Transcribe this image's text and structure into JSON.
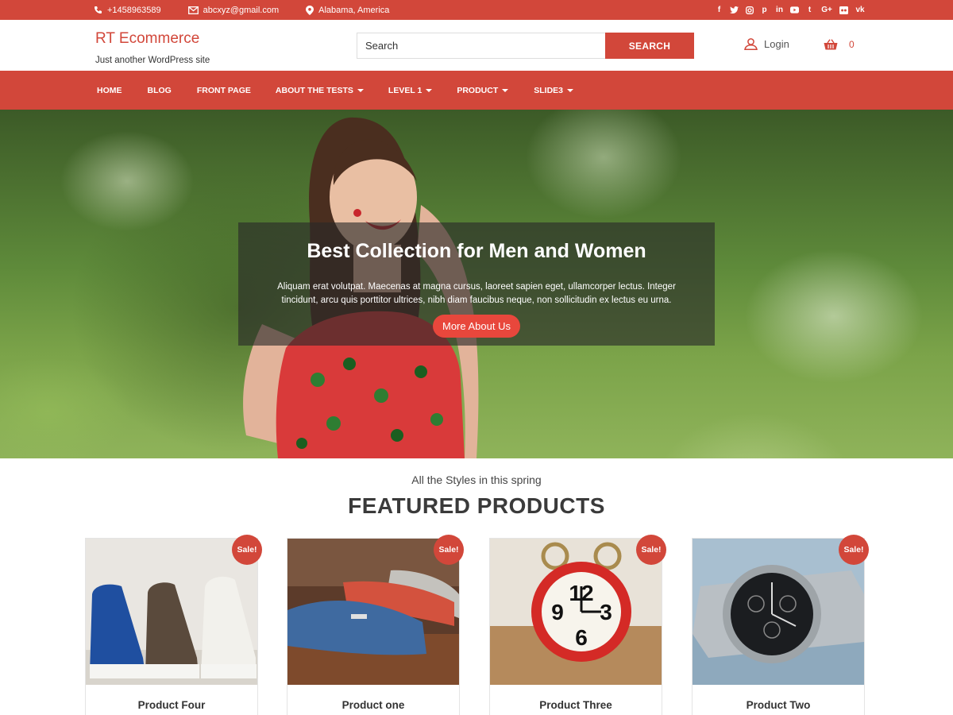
{
  "topbar": {
    "phone": "+1458963589",
    "email": "abcxyz@gmail.com",
    "location": "Alabama, America",
    "social": [
      {
        "icon": "facebook-icon",
        "glyph": "f"
      },
      {
        "icon": "twitter-icon",
        "glyph": "t"
      },
      {
        "icon": "instagram-icon",
        "glyph": "◎"
      },
      {
        "icon": "pinterest-icon",
        "glyph": "p"
      },
      {
        "icon": "linkedin-icon",
        "glyph": "in"
      },
      {
        "icon": "youtube-icon",
        "glyph": "▶"
      },
      {
        "icon": "tumblr-icon",
        "glyph": "t"
      },
      {
        "icon": "google-plus-icon",
        "glyph": "G+"
      },
      {
        "icon": "flickr-icon",
        "glyph": "••"
      },
      {
        "icon": "vk-icon",
        "glyph": "vk"
      }
    ]
  },
  "header": {
    "site_name": "RT Ecommerce",
    "tagline": "Just another WordPress site",
    "search_placeholder": "Search",
    "search_button": "SEARCH",
    "login_label": "Login",
    "cart_count": "0"
  },
  "nav": {
    "items": [
      {
        "label": "HOME",
        "dropdown": false
      },
      {
        "label": "BLOG",
        "dropdown": false
      },
      {
        "label": "FRONT PAGE",
        "dropdown": false
      },
      {
        "label": "ABOUT THE TESTS",
        "dropdown": true
      },
      {
        "label": "LEVEL 1",
        "dropdown": true
      },
      {
        "label": "PRODUCT",
        "dropdown": true
      },
      {
        "label": "SLIDE3",
        "dropdown": true
      }
    ]
  },
  "hero": {
    "title": "Best Collection for Men and Women",
    "text": "Aliquam erat volutpat. Maecenas at magna cursus, laoreet sapien eget, ullamcorper lectus. Integer tincidunt, arcu quis porttitor ultrices, nibh diam faucibus neque, non sollicitudin ex lectus eu urna.",
    "button": "More About Us"
  },
  "featured": {
    "subtitle": "All the Styles in this spring",
    "title": "FEATURED PRODUCTS",
    "products": [
      {
        "name": "Product Four",
        "badge": "Sale!"
      },
      {
        "name": "Product one",
        "badge": "Sale!"
      },
      {
        "name": "Product Three",
        "badge": "Sale!"
      },
      {
        "name": "Product Two",
        "badge": "Sale!"
      }
    ]
  },
  "colors": {
    "accent": "#d2473a",
    "hero_button": "#e8473c"
  }
}
